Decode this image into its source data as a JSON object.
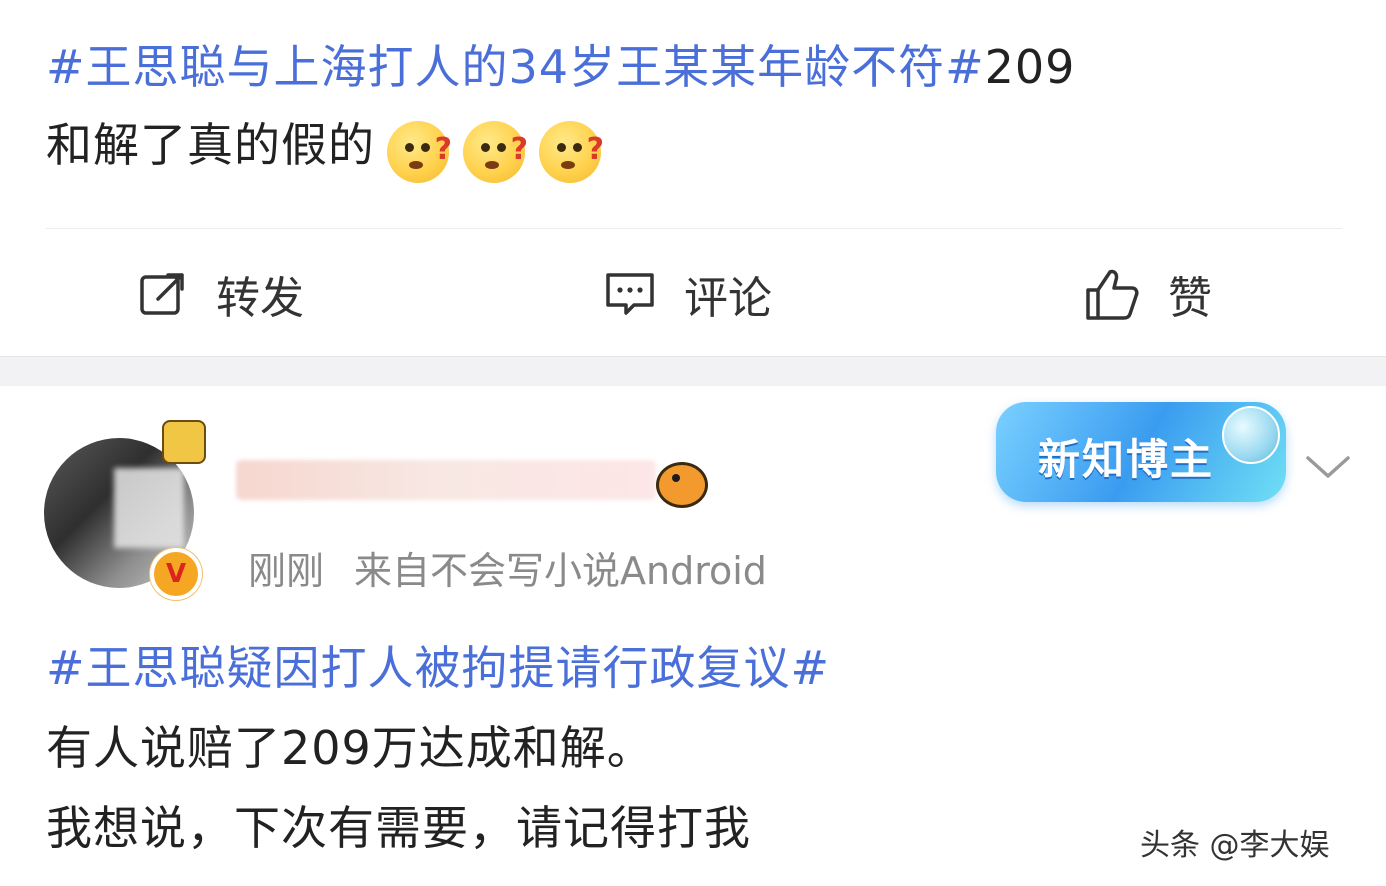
{
  "post1": {
    "hashtag": "#王思聪与上海打人的34岁王某某年龄不符#",
    "text_after_hashtag": "209",
    "line2": "和解了真的假的",
    "emoji_icon": "confused-face-emoji",
    "emoji_count": 3
  },
  "actions": {
    "repost_label": "转发",
    "comment_label": "评论",
    "like_label": "赞"
  },
  "post2": {
    "meta_time": "刚刚",
    "meta_source": "来自不会写小说Android",
    "badge_label": "新知博主",
    "hashtag": "#王思聪疑因打人被拘提请行政复议#",
    "line2": "有人说赔了209万达成和解。",
    "line3": "我想说，下次有需要，请记得打我"
  },
  "watermark": "头条 @李大娱",
  "colors": {
    "hashtag": "#4a6fd8",
    "meta": "#8a8a8a"
  }
}
